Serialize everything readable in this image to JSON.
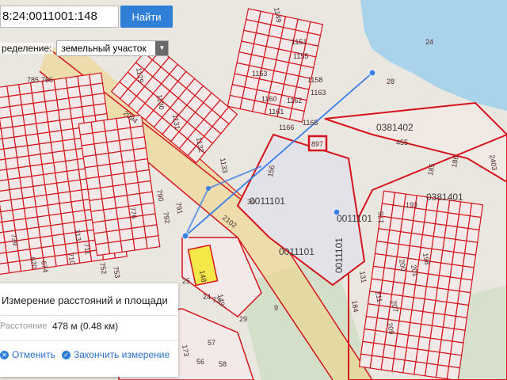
{
  "search": {
    "value": "8:24:0011001:148",
    "button_label": "Найти"
  },
  "definition": {
    "label": "ределение:",
    "selected": "земельный участок",
    "caret": "▼"
  },
  "panel": {
    "title": "Измерение расстояний и площади",
    "distance_label": "Расстояние",
    "distance_value": "478 м (0.48 км)",
    "cancel_label": "Отменить",
    "cancel_icon": "close-icon",
    "finish_label": "Закончить измерение",
    "finish_icon": "check-icon"
  },
  "map": {
    "colors": {
      "background": "#eae6e0",
      "water": "#a9d3ea",
      "parcel": "#d5141c",
      "parcel_fill": "#f3e9e9",
      "road": "#f0d58a",
      "measure": "#3a7ee6",
      "selected": "#f5e94a"
    },
    "labels": {
      "q1": "0381402",
      "q1b": "455",
      "q2": "0381401",
      "q3": "0011101",
      "q4": "0011101",
      "q5": "0011101",
      "q6": "0011101",
      "p24": "24",
      "p28": "28",
      "p897": "897",
      "p148": "148",
      "p156": "156",
      "p30": "30",
      "p2102": "2102",
      "p2094": "2094",
      "p2403": "2403",
      "p1130": "1130",
      "p1131": "1131",
      "p1132": "1132",
      "p1133": "1133",
      "p1129": "1129",
      "p1149": "1149",
      "p1151": "1151",
      "p1153": "1153",
      "p1155": "1155",
      "p1158": "1158",
      "p1160": "1160",
      "p1161": "1161",
      "p1162": "1162",
      "p1163": "1163",
      "p1166": "1166",
      "p1165": "1165",
      "p785": "785",
      "p766": "766",
      "p790": "790",
      "p792": "792",
      "p791": "791",
      "p776": "776",
      "p739": "739",
      "p713": "713",
      "p711": "711",
      "p710": "710",
      "p670": "670",
      "p674": "674",
      "p752": "752",
      "p753": "753",
      "p176": "176",
      "p193": "193",
      "p200": "200",
      "p201": "201",
      "p207": "207",
      "p209": "209",
      "p211": "211",
      "p184": "184",
      "p131": "131",
      "p198": "198",
      "p186": "186",
      "p185": "185",
      "p173": "173",
      "p57": "57",
      "p58": "58",
      "p56": "56",
      "p73": "73",
      "p149": "149",
      "p25": "25",
      "p24b": "24",
      "p29": "29",
      "p9": "9"
    }
  }
}
